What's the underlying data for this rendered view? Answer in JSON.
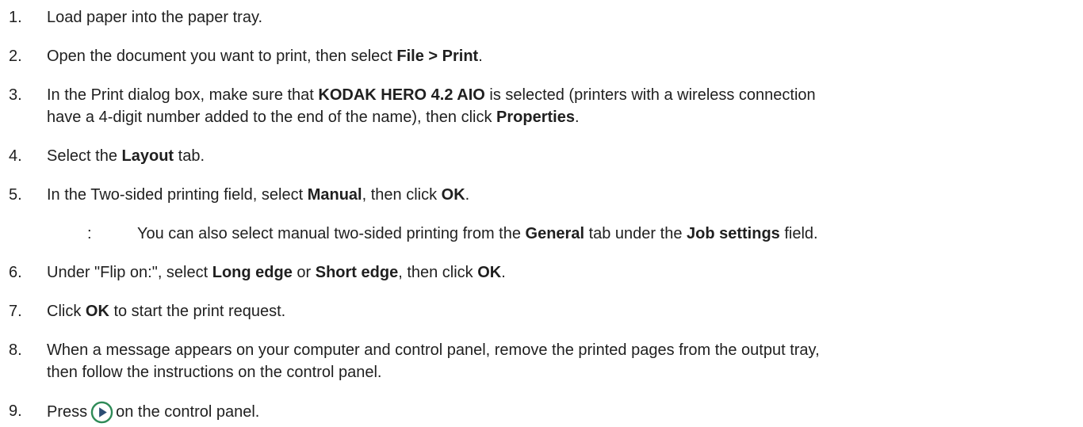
{
  "steps": [
    {
      "num": "1.",
      "parts": [
        "Load paper into the paper tray."
      ]
    },
    {
      "num": "2.",
      "parts": [
        "Open the document you want to print, then select ",
        "File > Print",
        "."
      ]
    },
    {
      "num": "3.",
      "line1": [
        "In the Print dialog box, make sure that ",
        "KODAK HERO 4.2 AIO",
        " is selected (printers with a wireless connection"
      ],
      "line2": [
        "have a 4-digit number added to the end of the name), then click ",
        "Properties",
        "."
      ]
    },
    {
      "num": "4.",
      "parts": [
        "Select the ",
        "Layout",
        " tab."
      ]
    },
    {
      "num": "5.",
      "parts": [
        "In the Two-sided printing field, select ",
        "Manual",
        ", then click ",
        "OK",
        "."
      ]
    },
    {
      "num": "6.",
      "parts": [
        "Under \"Flip on:\", select ",
        "Long edge",
        " or ",
        "Short edge",
        ", then click ",
        "OK",
        "."
      ]
    },
    {
      "num": "7.",
      "parts": [
        "Click ",
        "OK",
        " to start the print request."
      ]
    },
    {
      "num": "8.",
      "line1": [
        "When a message appears on your computer and control panel, remove the printed pages from the output tray,"
      ],
      "line2": [
        "then follow the instructions on the control panel."
      ]
    },
    {
      "num": "9.",
      "before": "Press",
      "after": "on the control panel.",
      "icon": "start-button-icon"
    }
  ],
  "note": {
    "colon": ":",
    "parts": [
      "You can also select manual two-sided printing from the ",
      "General",
      " tab under the ",
      "Job settings",
      " field."
    ]
  },
  "colors": {
    "text": "#1f1f1f",
    "icon_ring": "#2e8a57",
    "icon_fill": "#2b4d73"
  }
}
